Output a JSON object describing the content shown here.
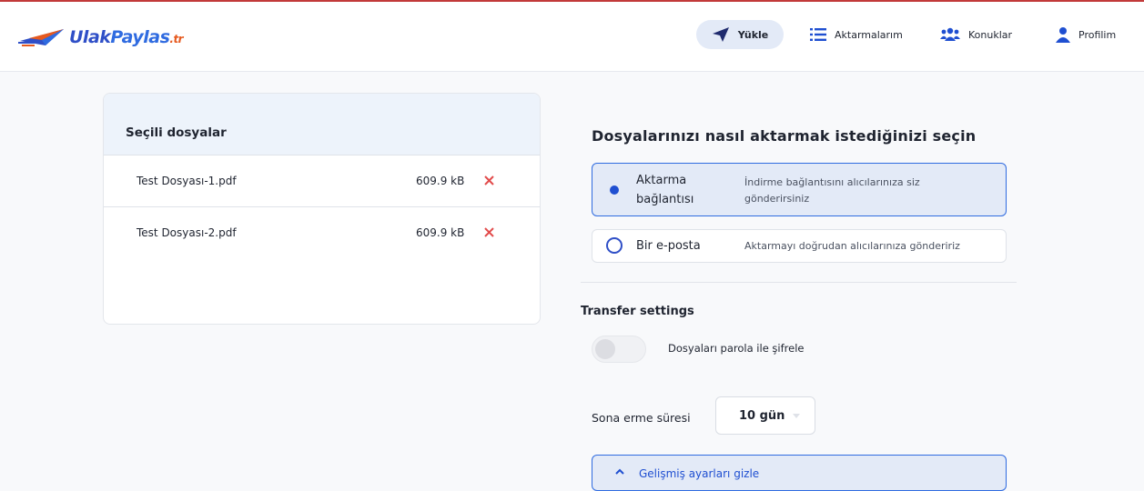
{
  "brand": {
    "name_part1": "Ulak",
    "name_part2": "Paylas",
    "tld": ".tr",
    "accent": "#2f4fc7",
    "logo_orange": "#e65a1f",
    "top_border": "#c23a3a"
  },
  "nav": {
    "upload": {
      "label": "Yükle",
      "icon": "paper-plane-icon"
    },
    "transfers": {
      "label": "Aktarmalarım",
      "icon": "list-icon"
    },
    "contacts": {
      "label": "Konuklar",
      "icon": "users-icon"
    },
    "profile": {
      "label": "Profilim",
      "icon": "user-icon"
    }
  },
  "files_panel": {
    "title": "Seçili dosyalar",
    "files": [
      {
        "name": "Test Dosyası-1.pdf",
        "size": "609.9 kB"
      },
      {
        "name": "Test Dosyası-2.pdf",
        "size": "609.9 kB"
      }
    ],
    "remove_icon": "close-icon",
    "remove_color": "#e24b4b"
  },
  "transfer_method": {
    "title": "Dosyalarınızı nasıl aktarmak istediğinizi seçin",
    "options": [
      {
        "label_line1": "Aktarma",
        "label_line2": "bağlantısı",
        "desc_line1": "İndirme bağlantısını alıcılarınıza siz",
        "desc_line2": "gönderirsiniz",
        "selected": true
      },
      {
        "label": "Bir e-posta",
        "desc": "Aktarmayı doğrudan alıcılarınıza göndeririz",
        "selected": false
      }
    ]
  },
  "settings": {
    "title": "Transfer settings",
    "password_toggle": {
      "label": "Dosyaları parola ile şifrele",
      "on": false
    },
    "expiry": {
      "label": "Sona erme süresi",
      "value": "10 gün"
    },
    "advanced": {
      "label": "Gelişmiş ayarları gizle",
      "icon": "chevron-up-icon"
    }
  }
}
